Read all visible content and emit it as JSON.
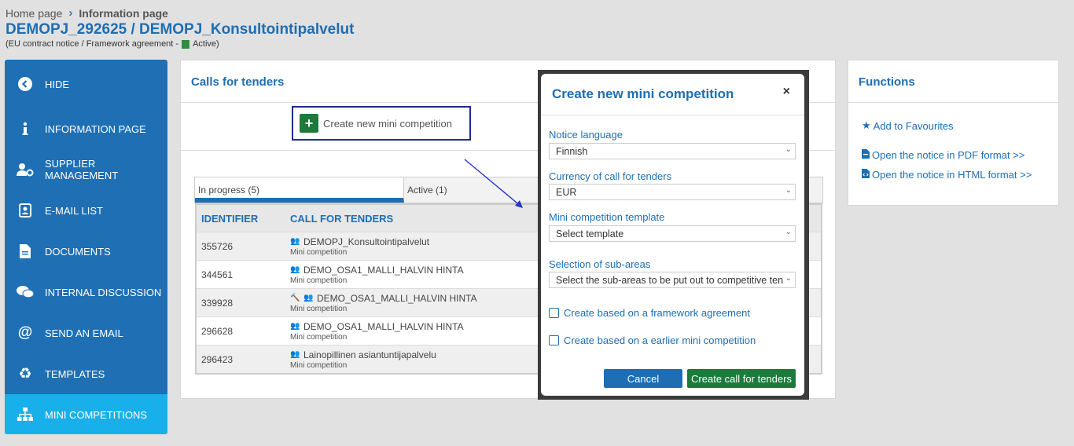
{
  "breadcrumb": {
    "home": "Home page",
    "current": "Information page"
  },
  "page_title": "DEMOPJ_292625 / DEMOPJ_Konsultointipalvelut",
  "subtitle": {
    "prefix": "(EU contract notice / Framework agreement -",
    "status": "Active)"
  },
  "sidebar": {
    "items": [
      {
        "label": "HIDE",
        "icon": "chevron-left-icon"
      },
      {
        "label": "INFORMATION PAGE",
        "icon": "info-icon"
      },
      {
        "label": "SUPPLIER MANAGEMENT",
        "icon": "user-gear-icon"
      },
      {
        "label": "E-MAIL LIST",
        "icon": "contact-card-icon"
      },
      {
        "label": "DOCUMENTS",
        "icon": "document-icon"
      },
      {
        "label": "INTERNAL DISCUSSION",
        "icon": "chat-icon"
      },
      {
        "label": "SEND AN EMAIL",
        "icon": "at-icon"
      },
      {
        "label": "TEMPLATES",
        "icon": "recycle-icon"
      },
      {
        "label": "MINI COMPETITIONS",
        "icon": "sitemap-icon"
      }
    ]
  },
  "calls": {
    "title": "Calls for tenders",
    "create_label": "Create new mini competition",
    "tabs": [
      "In progress (5)",
      "Active (1)"
    ],
    "headers": [
      "IDENTIFIER",
      "CALL FOR TENDERS"
    ],
    "rows": [
      {
        "id": "355726",
        "name": "DEMOPJ_Konsultointipalvelut",
        "type": "Mini competition"
      },
      {
        "id": "344561",
        "name": "DEMO_OSA1_MALLI_HALVIN HINTA",
        "type": "Mini competition"
      },
      {
        "id": "339928",
        "name": "DEMO_OSA1_MALLI_HALVIN HINTA",
        "type": "Mini competition"
      },
      {
        "id": "296628",
        "name": "DEMO_OSA1_MALLI_HALVIN HINTA",
        "type": "Mini competition"
      },
      {
        "id": "296423",
        "name": "Lainopillinen asiantuntijapalvelu",
        "type": "Mini competition"
      }
    ]
  },
  "functions": {
    "title": "Functions",
    "favourites": "Add to Favourites",
    "pdf": "Open the notice in PDF format >>",
    "html": "Open the notice in HTML format >>"
  },
  "modal": {
    "title": "Create new mini competition",
    "close": "×",
    "language_label": "Notice language",
    "language_value": "Finnish",
    "currency_label": "Currency of call for tenders",
    "currency_value": "EUR",
    "template_label": "Mini competition template",
    "template_value": "Select template",
    "subareas_label": "Selection of sub-areas",
    "subareas_value": "Select the sub-areas to be put out to competitive ten",
    "check1": "Create based on a framework agreement",
    "check2": "Create based on a earlier mini competition",
    "cancel": "Cancel",
    "create": "Create call for tenders"
  },
  "colors": {
    "primary": "#1f6db3",
    "sidebar": "#1e6fb4",
    "active": "#18b0ea",
    "green": "#1d7a3b"
  }
}
